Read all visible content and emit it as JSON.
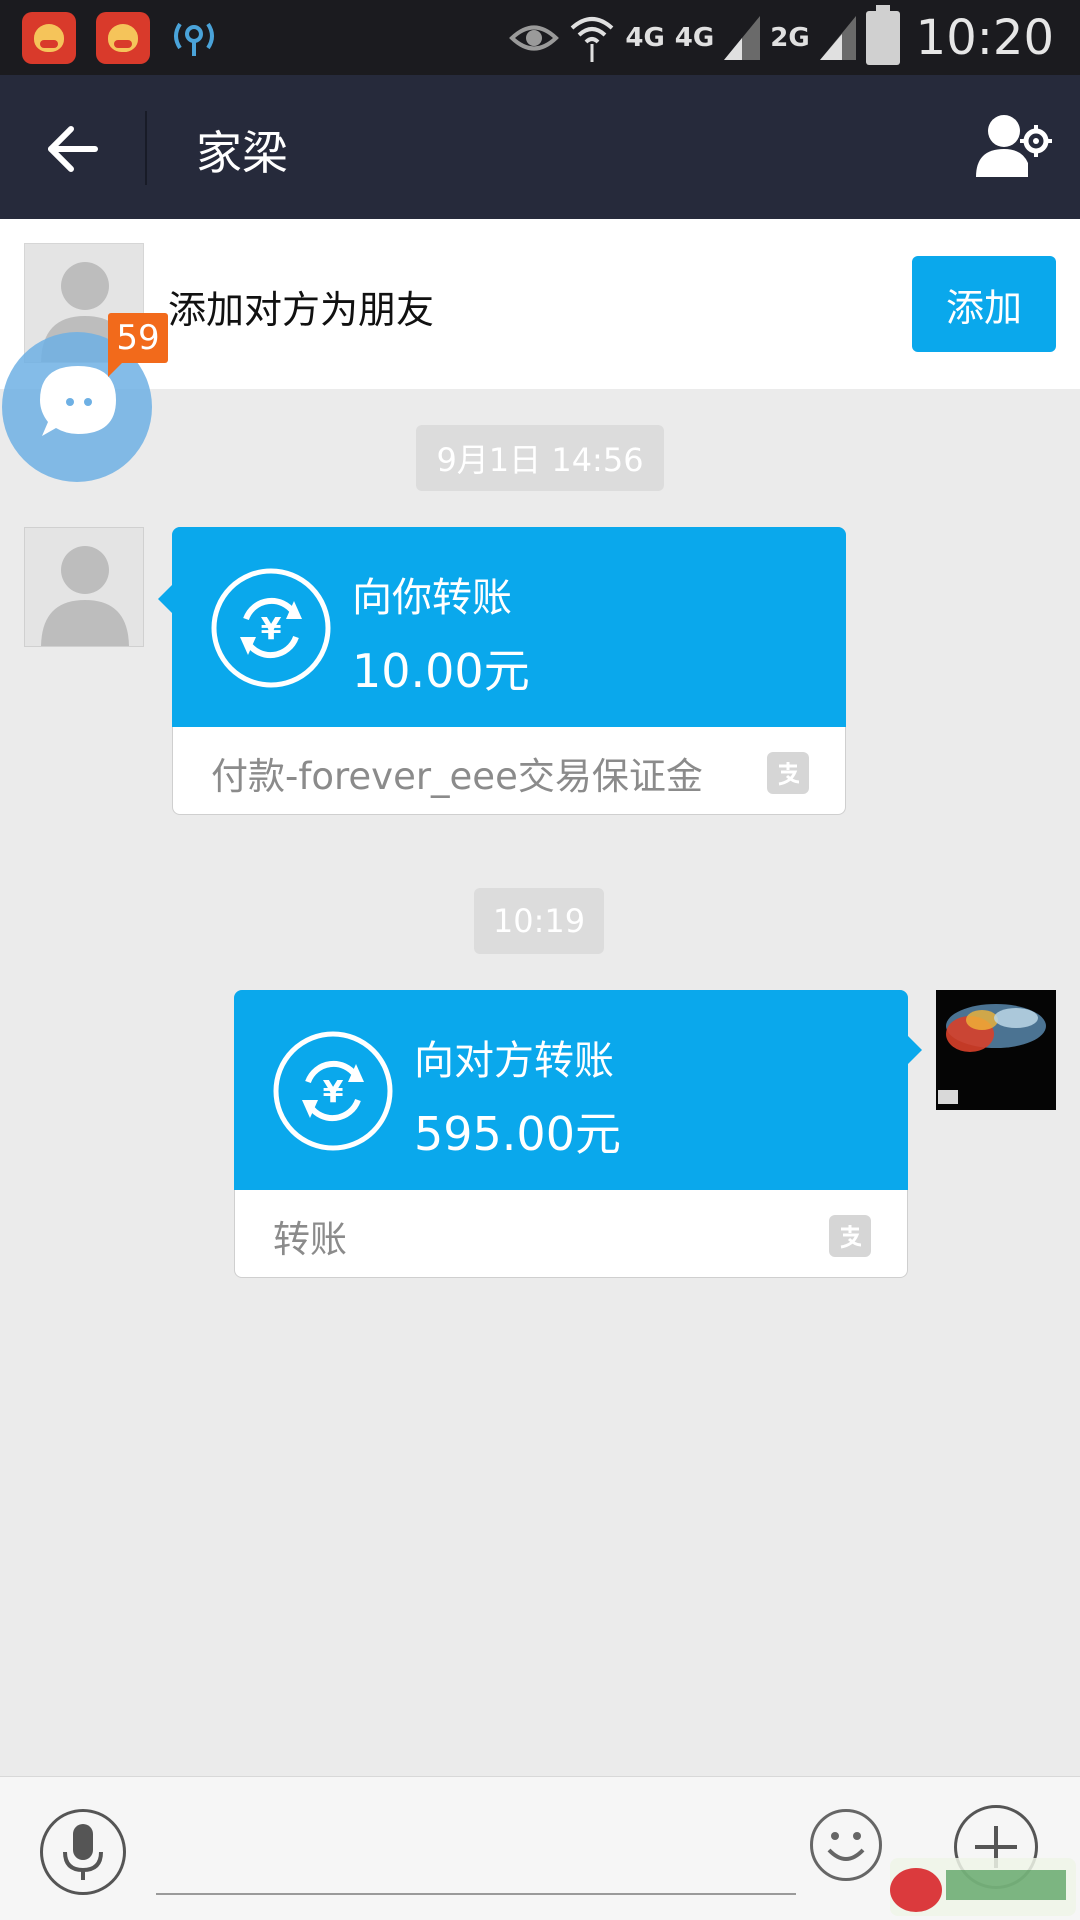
{
  "status_bar": {
    "net_labels": [
      "4G",
      "4G",
      "2G"
    ],
    "time": "10:20"
  },
  "header": {
    "title": "家梁"
  },
  "add_friend": {
    "text": "添加对方为朋友",
    "button_label": "添加"
  },
  "floating_badge": {
    "count": "59"
  },
  "messages": [
    {
      "timestamp": "9月1日 14:56",
      "title": "向你转账",
      "amount": "10.00元",
      "note": "付款-forever_eee交易保证金"
    },
    {
      "timestamp": "10:19",
      "title": "向对方转账",
      "amount": "595.00元",
      "note": "转账"
    }
  ],
  "colors": {
    "accent": "#0aa8ec",
    "header_bg": "#262a3b",
    "badge": "#f26a1b"
  },
  "icons": {
    "back": "arrow-left-icon",
    "profile": "user-gear-icon",
    "voice": "microphone-icon",
    "emoji": "smiley-icon",
    "more": "plus-icon",
    "transfer": "yuan-exchange-icon",
    "alipay": "alipay-icon"
  }
}
